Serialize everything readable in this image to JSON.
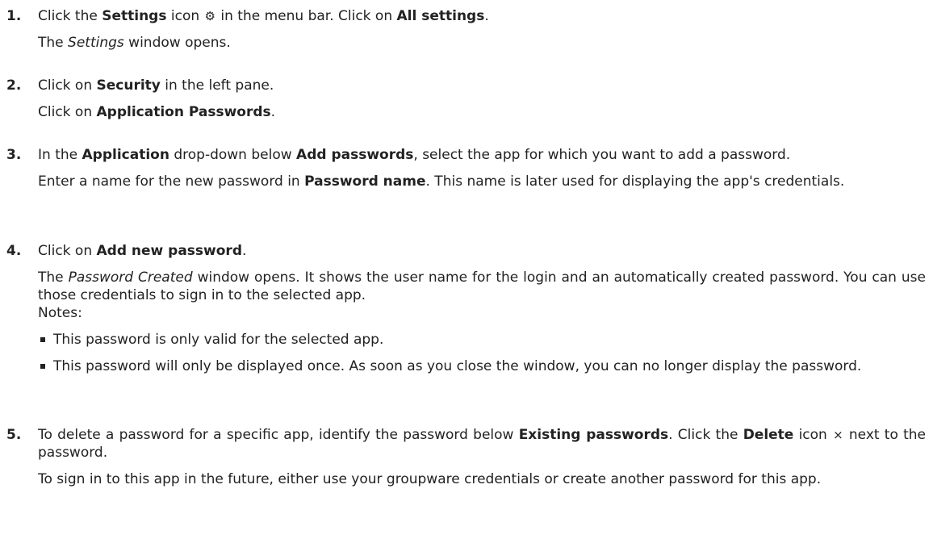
{
  "steps": [
    {
      "number": "1.",
      "line1": {
        "pre": "Click the ",
        "b1": "Settings",
        "mid": " icon ",
        "icon": "⚙",
        "mid2": " in the menu bar. Click on ",
        "b2": "All settings",
        "post": "."
      },
      "line2": {
        "pre": "The ",
        "em": "Settings",
        "post": " window opens."
      }
    },
    {
      "number": "2.",
      "line1": {
        "pre": "Click on ",
        "b": "Security",
        "post": " in the left pane."
      },
      "line2": {
        "pre": "Click on ",
        "b": "Application Passwords",
        "post": "."
      }
    },
    {
      "number": "3.",
      "line1": {
        "pre": "In the ",
        "b1": "Application",
        "mid": " drop-down below ",
        "b2": "Add passwords",
        "post": ", select the app for which you want to add a password."
      },
      "line2": {
        "pre": "Enter a name for the new password in ",
        "b": "Password name",
        "post": ". This name is later used for displaying the app's credentials."
      }
    },
    {
      "number": "4.",
      "line1": {
        "pre": "Click on ",
        "b": "Add new password",
        "post": "."
      },
      "line2": {
        "pre": "The ",
        "em": "Password Created",
        "post": " window opens. It shows the user name for the login and an automatically created password. You can use those credentials to sign in to the selected app."
      },
      "notes_label": "Notes:",
      "bullets": [
        "This password is only valid for the selected app.",
        "This password will only be displayed once. As soon as you close the window, you can no longer display the password."
      ]
    },
    {
      "number": "5.",
      "line1": {
        "pre": "To delete a password for a specific app, identify the password below ",
        "b1": "Existing passwords",
        "mid": ". Click the ",
        "b2": "Delete",
        "mid2": " icon ",
        "icon": "×",
        "post": " next to the password."
      },
      "line2": "To sign in to this app in the future, either use your groupware credentials or create another password for this app."
    }
  ]
}
